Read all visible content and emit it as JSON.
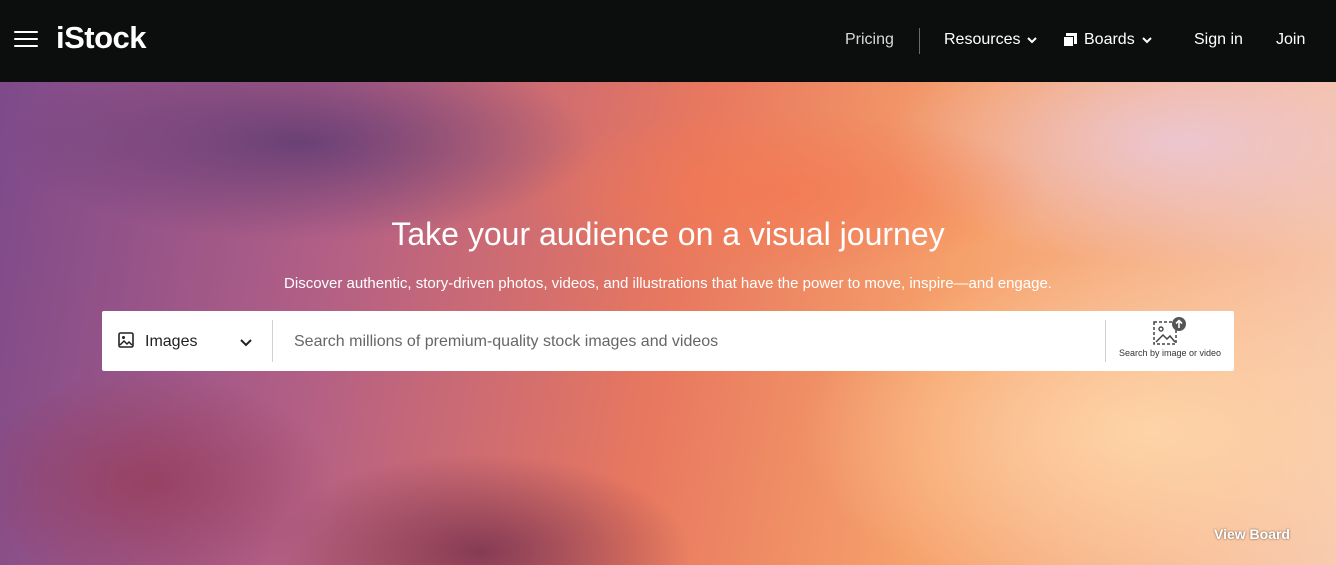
{
  "brand": {
    "logo_text": "iStock"
  },
  "nav": {
    "pricing": "Pricing",
    "resources": "Resources",
    "boards": "Boards",
    "sign_in": "Sign in",
    "join": "Join"
  },
  "hero": {
    "title": "Take your audience on a visual journey",
    "subtitle": "Discover authentic, story-driven photos, videos, and illustrations that have the power to move, inspire—and engage."
  },
  "search": {
    "type_selected": "Images",
    "placeholder": "Search millions of premium-quality stock images and videos",
    "value": "",
    "visual_search_label": "Search by image or video"
  },
  "view_board": "View Board",
  "icons": [
    "menu-icon",
    "chevron-down-icon",
    "boards-icon",
    "image-icon",
    "search-by-image-icon"
  ],
  "colors": {
    "topbar": "#0c0d0d",
    "text_light": "#ffffff"
  }
}
